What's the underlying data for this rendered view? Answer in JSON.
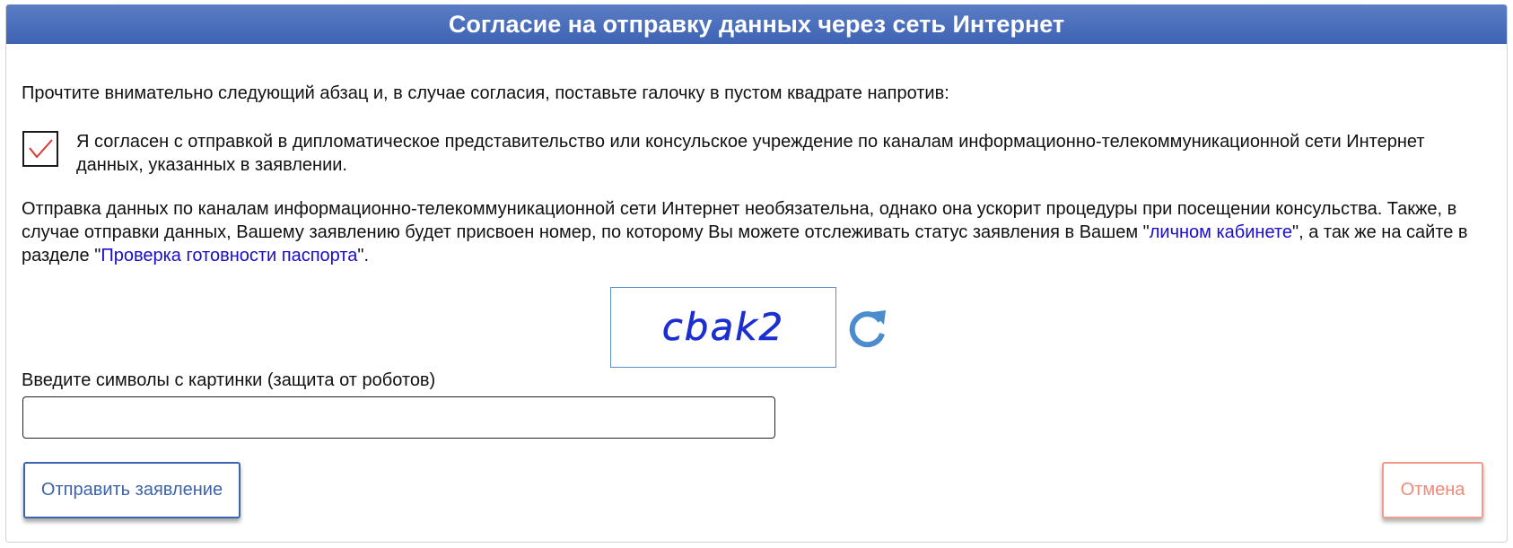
{
  "dialog": {
    "title": "Согласие на отправку данных через сеть Интернет",
    "instruction": "Прочтите внимательно следующий абзац и, в случае согласия, поставьте галочку в пустом квадрате напротив:",
    "consent": {
      "checked": true,
      "text": "Я согласен с отправкой в дипломатическое представительство или консульское учреждение по каналам информационно-телекоммуникационной сети Интернет данных, указанных в заявлении."
    },
    "info": {
      "part1": "Отправка данных по каналам информационно-телекоммуникационной сети Интернет необязательна, однако она ускорит процедуры при посещении консульства. Также, в случае отправки данных, Вашему заявлению будет присвоен номер, по которому Вы можете отслеживать статус заявления в Вашем \"",
      "link1": "личном кабинете",
      "part2": "\", а так же на сайте в разделе \"",
      "link2": "Проверка готовности паспорта",
      "part3": "\"."
    },
    "captcha": {
      "image_text": "cbak2",
      "refresh_icon": "refresh-icon",
      "label": "Введите символы с картинки (защита от роботов)",
      "value": "",
      "placeholder": ""
    },
    "buttons": {
      "submit_label": "Отправить заявление",
      "cancel_label": "Отмена"
    }
  },
  "colors": {
    "header_bg": "#4a6fbe",
    "link": "#1a0dcc",
    "checkmark": "#e0342a",
    "captcha_text": "#1b2fd0",
    "refresh": "#4a8ccd",
    "submit_border": "#3d63ad",
    "cancel_text": "#ef8a7a"
  }
}
